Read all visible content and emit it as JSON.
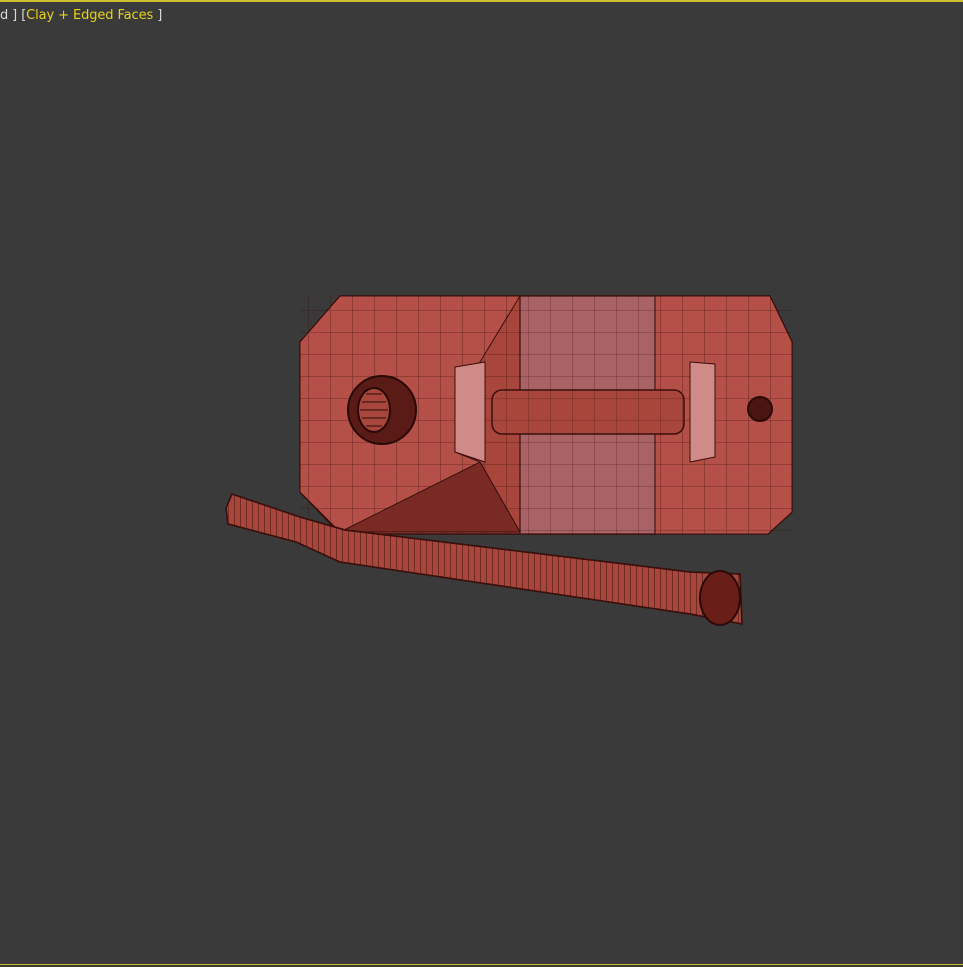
{
  "viewport": {
    "label_prefix": "d ] [",
    "shading_mode": "Clay + Edged Faces",
    "label_suffix": " ]",
    "border_color": "#c9bd2e",
    "background": "#3a3a3a"
  },
  "model": {
    "colors": {
      "base": "#a8463c",
      "light": "#c06158",
      "dark": "#7a2a24",
      "wire": "#3a0f0c",
      "handle_pink": "#a96266"
    }
  }
}
